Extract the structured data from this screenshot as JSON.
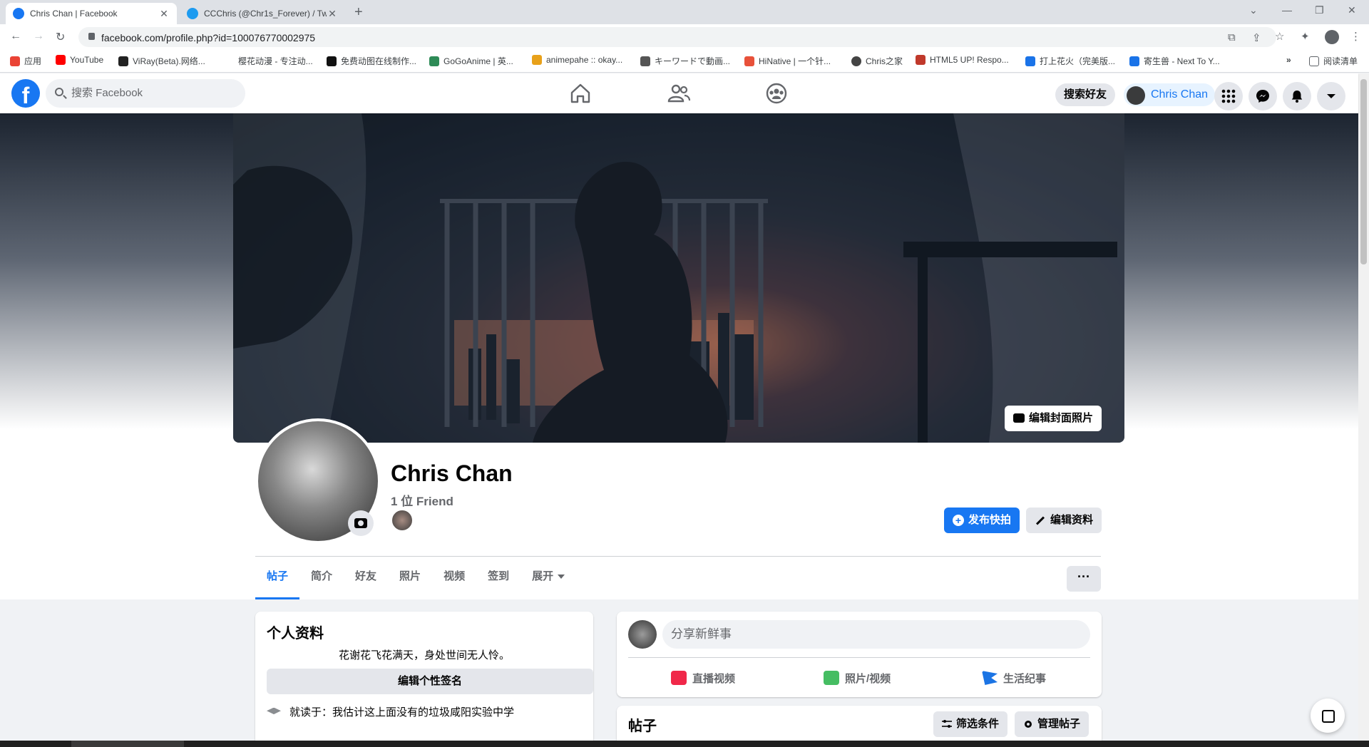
{
  "browser": {
    "tabs": [
      {
        "title": "Chris Chan | Facebook",
        "favicon": "facebook-icon",
        "active": true
      },
      {
        "title": "CCChris (@Chr1s_Forever) / Tw",
        "favicon": "twitter-icon",
        "active": false
      }
    ],
    "new_tab": "+",
    "url": "facebook.com/profile.php?id=100076770002975",
    "bookmarks": [
      {
        "label": "应用",
        "color": "#ea4335"
      },
      {
        "label": "YouTube",
        "color": "#ff0000"
      },
      {
        "label": "ViRay(Beta).网络...",
        "color": "#222222"
      },
      {
        "label": "樱花动漫 - 专注动...",
        "color": "#ffffff"
      },
      {
        "label": "免费动图在线制作...",
        "color": "#111111"
      },
      {
        "label": "GoGoAnime | 英...",
        "color": "#2e8b57"
      },
      {
        "label": "animepahe :: okay...",
        "color": "#e8a11a"
      },
      {
        "label": "キーワードで動画...",
        "color": "#555555"
      },
      {
        "label": "HiNative | 一个针...",
        "color": "#e8513a"
      },
      {
        "label": "Chris之家",
        "color": "#444444"
      },
      {
        "label": "HTML5 UP! Respo...",
        "color": "#c0392b"
      },
      {
        "label": "打上花火（完美版...",
        "color": "#1a73e8"
      },
      {
        "label": "寄生兽 - Next To Y...",
        "color": "#1a73e8"
      }
    ],
    "more_bookmarks": "»",
    "reading_list": "阅读清单"
  },
  "fb_header": {
    "logo": "f",
    "search_placeholder": "搜索 Facebook",
    "find_friends": "搜索好友",
    "user_name": "Chris Chan"
  },
  "profile": {
    "edit_cover": "编辑封面照片",
    "name": "Chris Chan",
    "friends": "1 位 Friend",
    "add_story": "发布快拍",
    "edit_profile": "编辑资料",
    "tabs": [
      "帖子",
      "简介",
      "好友",
      "照片",
      "视频",
      "签到",
      "展开"
    ],
    "more": "···"
  },
  "intro": {
    "title": "个人资料",
    "bio": "花谢花飞花满天，身处世间无人怜。",
    "edit_bio": "编辑个性签名",
    "school": "就读于：我估计这上面没有的垃圾咸阳实验中学"
  },
  "composer": {
    "placeholder": "分享新鲜事",
    "actions": [
      {
        "label": "直播视频",
        "color": "#f02849"
      },
      {
        "label": "照片/视频",
        "color": "#45bd62"
      },
      {
        "label": "生活纪事",
        "color": "#1b74e4"
      }
    ]
  },
  "posts": {
    "title": "帖子",
    "filter": "筛选条件",
    "manage": "管理帖子"
  },
  "colors": {
    "fb_blue": "#1877f2",
    "bg": "#f0f2f5"
  }
}
